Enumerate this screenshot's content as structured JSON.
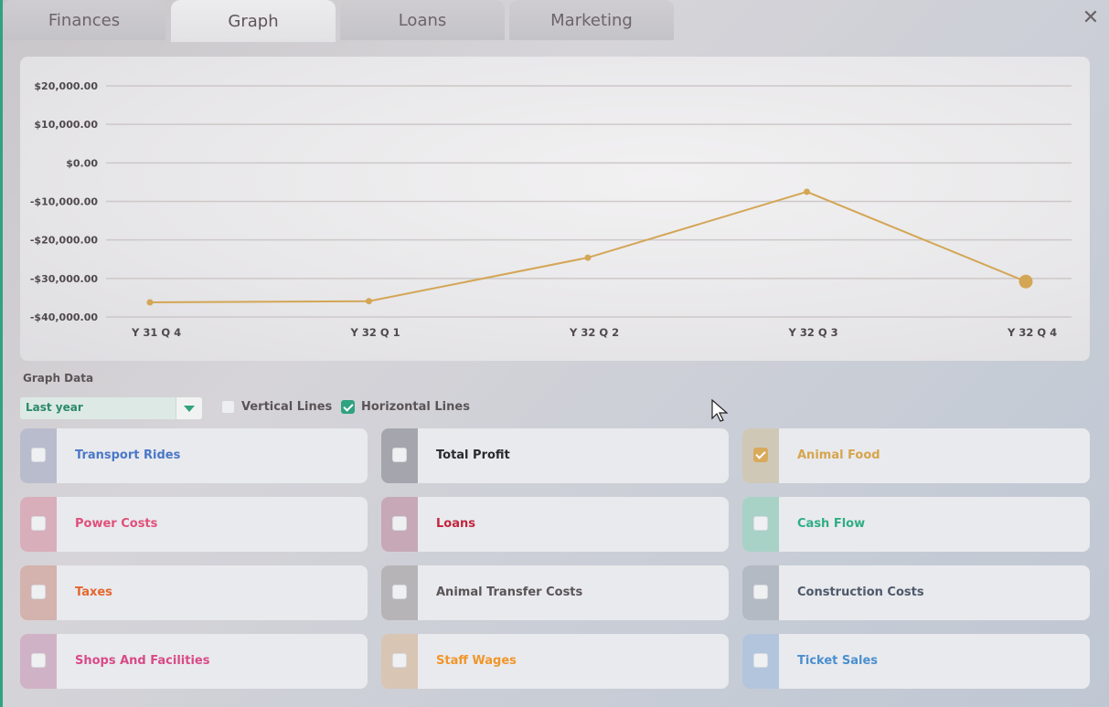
{
  "tabs": [
    {
      "label": "Finances",
      "active": false
    },
    {
      "label": "Graph",
      "active": true
    },
    {
      "label": "Loans",
      "active": false
    },
    {
      "label": "Marketing",
      "active": false
    }
  ],
  "close_icon": "close-icon",
  "chart_data": {
    "type": "line",
    "title": "",
    "xlabel": "",
    "ylabel": "",
    "categories": [
      "Y 31 Q 4",
      "Y 32 Q 1",
      "Y 32 Q 2",
      "Y 32 Q 3",
      "Y 32 Q 4"
    ],
    "y_ticks": [
      "$20,000.00",
      "$10,000.00",
      "$0.00",
      "-$10,000.00",
      "-$20,000.00",
      "-$30,000.00",
      "-$40,000.00"
    ],
    "ylim": [
      -40000,
      20000
    ],
    "horizontal_grid": true,
    "vertical_grid": false,
    "series": [
      {
        "color": "#d3a656",
        "values": [
          -36200,
          -35900,
          -24600,
          -7500,
          -30800
        ]
      }
    ]
  },
  "graph_data": {
    "section_label": "Graph Data",
    "period_select": "Last year",
    "vertical_lines": {
      "label": "Vertical Lines",
      "checked": false
    },
    "horizontal_lines": {
      "label": "Horizontal Lines",
      "checked": true
    }
  },
  "categories": [
    {
      "label": "Transport Rides",
      "color": "#4a78c8",
      "swatch": "#b9bccd",
      "checked": false
    },
    {
      "label": "Total Profit",
      "color": "#2a2a2e",
      "swatch": "#a5a5ad",
      "checked": false
    },
    {
      "label": "Animal Food",
      "color": "#d6a54e",
      "swatch": "#cfc8b6",
      "checked": true
    },
    {
      "label": "Power Costs",
      "color": "#e0507a",
      "swatch": "#d8aeba",
      "checked": false
    },
    {
      "label": "Loans",
      "color": "#c2253d",
      "swatch": "#c7a8b6",
      "checked": false
    },
    {
      "label": "Cash Flow",
      "color": "#2fae82",
      "swatch": "#a8d2c6",
      "checked": false
    },
    {
      "label": "Taxes",
      "color": "#e4672e",
      "swatch": "#d4b2ad",
      "checked": false
    },
    {
      "label": "Animal Transfer Costs",
      "color": "#5b5457",
      "swatch": "#b7b4b8",
      "checked": false
    },
    {
      "label": "Construction Costs",
      "color": "#4d5a6a",
      "swatch": "#b4bac4",
      "checked": false
    },
    {
      "label": "Shops And Facilities",
      "color": "#d94a87",
      "swatch": "#d0b2c6",
      "checked": false
    },
    {
      "label": "Staff Wages",
      "color": "#f0962a",
      "swatch": "#d8c5b3",
      "checked": false
    },
    {
      "label": "Ticket Sales",
      "color": "#4a8fcf",
      "swatch": "#b2c5dd",
      "checked": false
    }
  ]
}
